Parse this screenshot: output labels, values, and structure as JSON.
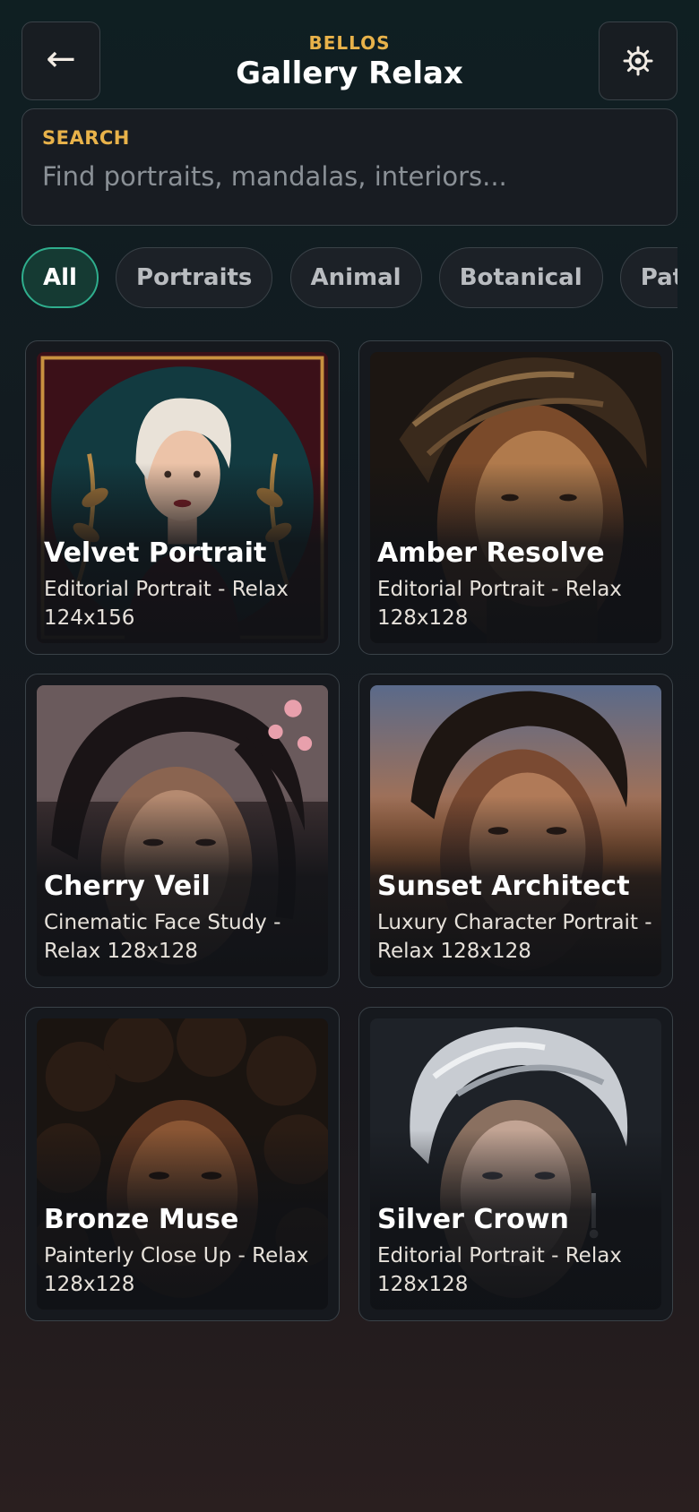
{
  "header": {
    "brand": "BELLOS",
    "title": "Gallery Relax",
    "back_icon": "arrow-left-icon",
    "settings_icon": "gear-icon"
  },
  "search": {
    "label": "SEARCH",
    "placeholder": "Find portraits, mandalas, interiors...",
    "value": ""
  },
  "filters": [
    {
      "label": "All",
      "active": true
    },
    {
      "label": "Portraits",
      "active": false
    },
    {
      "label": "Animal",
      "active": false
    },
    {
      "label": "Botanical",
      "active": false
    },
    {
      "label": "Patterns",
      "active": false
    }
  ],
  "cards": [
    {
      "title": "Velvet Portrait",
      "subtitle": "Editorial Portrait - Relax 124x156"
    },
    {
      "title": "Amber Resolve",
      "subtitle": "Editorial Portrait - Relax 128x128"
    },
    {
      "title": "Cherry Veil",
      "subtitle": "Cinematic Face Study - Relax 128x128"
    },
    {
      "title": "Sunset Architect",
      "subtitle": "Luxury Character Portrait - Relax 128x128"
    },
    {
      "title": "Bronze Muse",
      "subtitle": "Painterly Close Up - Relax 128x128"
    },
    {
      "title": "Silver Crown",
      "subtitle": "Editorial Portrait - Relax 128x128"
    }
  ],
  "colors": {
    "accent_gold": "#e8b24a",
    "active_chip_border": "#2fae8d",
    "card_border": "#3a4248"
  }
}
